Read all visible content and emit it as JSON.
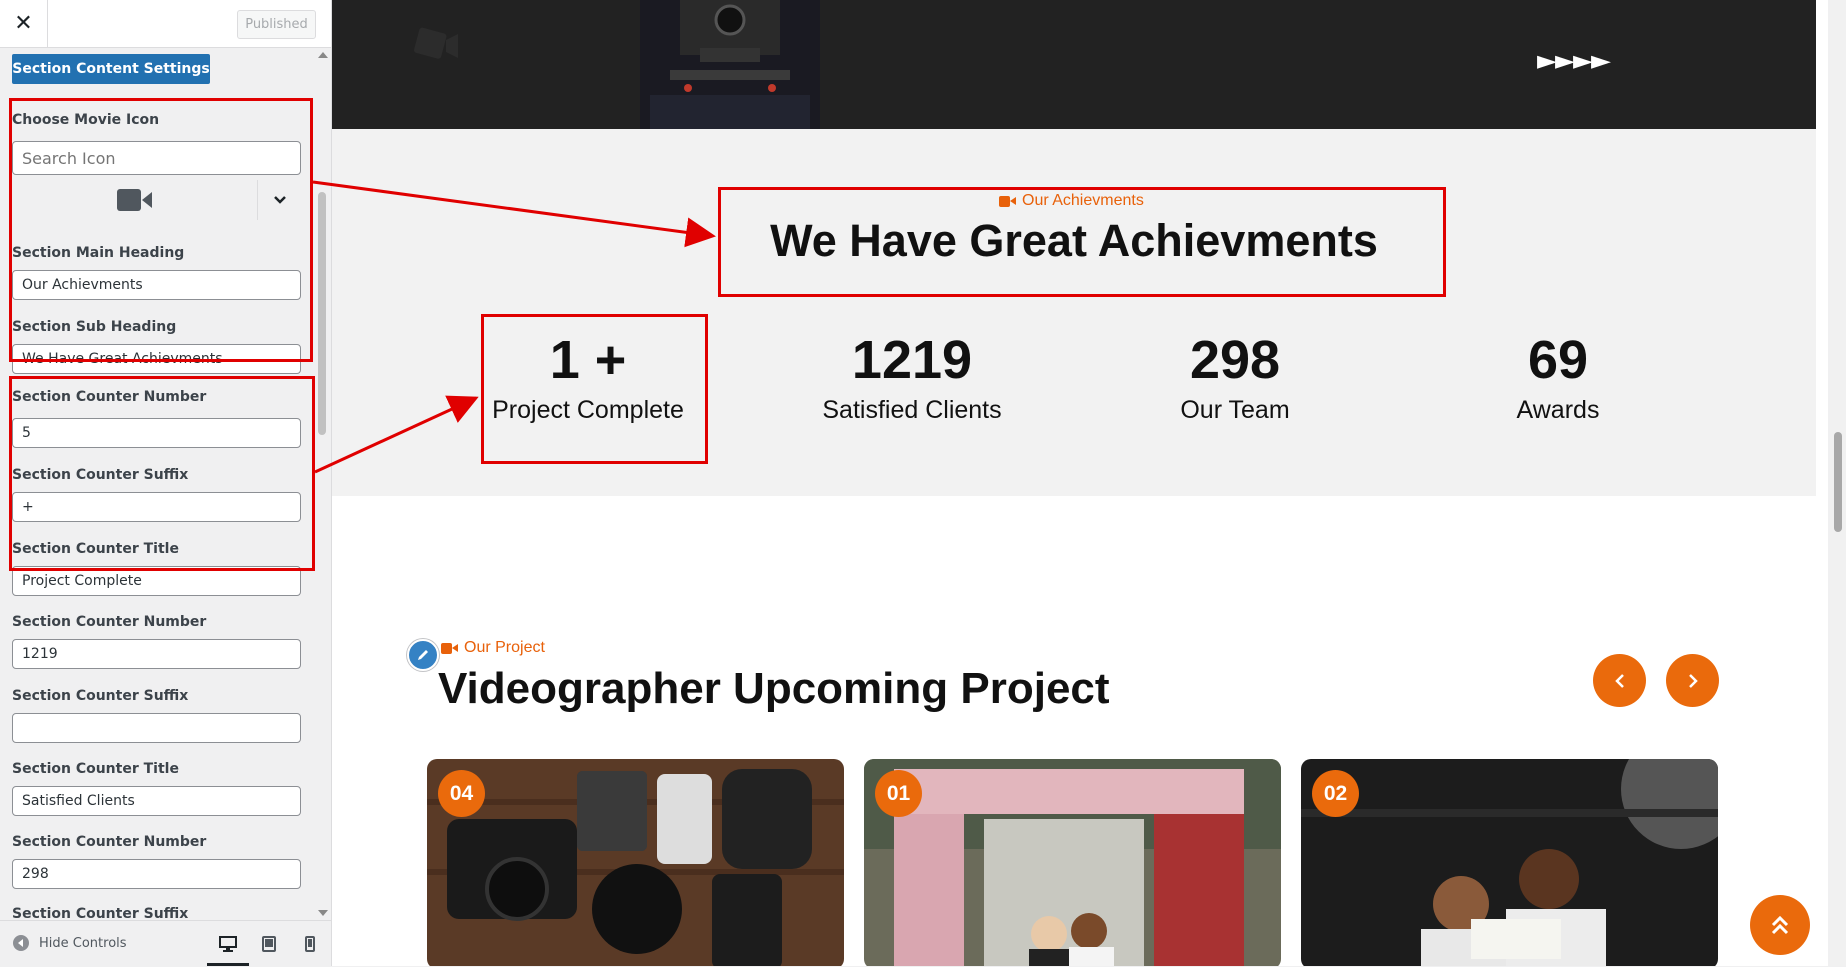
{
  "sidebar": {
    "close_label": "✕",
    "published_label": "Published",
    "section_button": "Section Content Settings",
    "movie_icon_label": "Choose Movie Icon",
    "icon_search_placeholder": "Search Icon",
    "selected_icon": "video-camera-icon",
    "fields": [
      {
        "label": "Section Main Heading",
        "value": "Our Achievments"
      },
      {
        "label": "Section Sub Heading",
        "value": "We Have Great Achievments"
      },
      {
        "label": "Section Counter Number",
        "value": "5"
      },
      {
        "label": "Section Counter Suffix",
        "value": "+"
      },
      {
        "label": "Section Counter Title",
        "value": "Project Complete"
      },
      {
        "label": "Section Counter Number",
        "value": "1219"
      },
      {
        "label": "Section Counter Suffix",
        "value": ""
      },
      {
        "label": "Section Counter Title",
        "value": "Satisfied Clients"
      },
      {
        "label": "Section Counter Number",
        "value": "298"
      },
      {
        "label": "Section Counter Suffix",
        "value": ""
      }
    ],
    "hide_controls": "Hide Controls",
    "devices": [
      "desktop-icon",
      "tablet-icon",
      "mobile-icon"
    ]
  },
  "preview": {
    "hero_arrows": "►►►►",
    "achievements": {
      "subtitle": "Our Achievments",
      "heading": "We Have Great Achievments",
      "counters": [
        {
          "number": "1 +",
          "title": "Project Complete"
        },
        {
          "number": "1219",
          "title": "Satisfied Clients"
        },
        {
          "number": "298",
          "title": "Our Team"
        },
        {
          "number": "69",
          "title": "Awards"
        }
      ]
    },
    "projects": {
      "subtitle": "Our Project",
      "heading": "Videographer Upcoming Project",
      "cards": [
        {
          "badge": "04",
          "image": "camera-gear-flatlay"
        },
        {
          "badge": "01",
          "image": "wedding-flower-arch"
        },
        {
          "badge": "02",
          "image": "team-reviewing-photos"
        }
      ]
    }
  },
  "colors": {
    "accent": "#ea6a0c",
    "wp_blue": "#2271b1",
    "annotation_red": "#e00000"
  }
}
